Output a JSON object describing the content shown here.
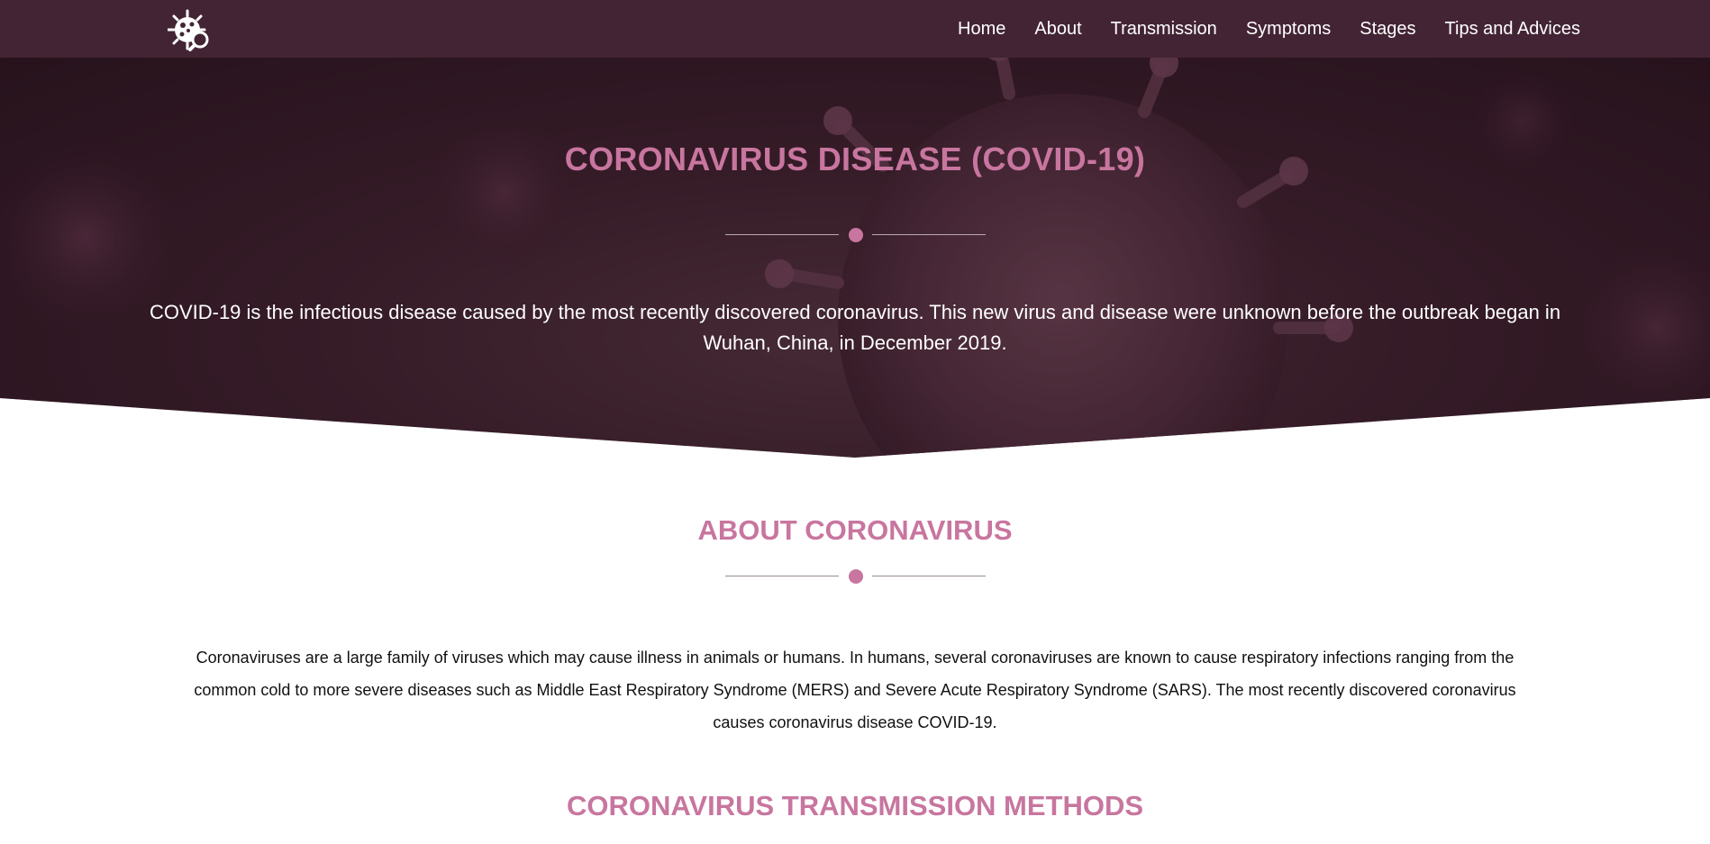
{
  "navbar": {
    "logo_icon": "virus-search-icon",
    "links": [
      "Home",
      "About",
      "Transmission",
      "Symptoms",
      "Stages",
      "Tips and Advices"
    ]
  },
  "hero": {
    "title": "CORONAVIRUS DISEASE (COVID-19)",
    "text": "COVID-19 is the infectious disease caused by the most recently discovered coronavirus. This new virus and disease were unknown before the outbreak began in Wuhan, China, in December 2019."
  },
  "about": {
    "title": "ABOUT CORONAVIRUS",
    "text": "Coronaviruses are a large family of viruses which may cause illness in animals or humans. In humans, several coronaviruses are known to cause respiratory infections ranging from the common cold to more severe diseases such as Middle East Respiratory Syndrome (MERS) and Severe Acute Respiratory Syndrome (SARS). The most recently discovered coronavirus causes coronavirus disease COVID-19."
  },
  "transmission": {
    "title": "CORONAVIRUS TRANSMISSION METHODS"
  },
  "colors": {
    "navbar_bg": "#432434",
    "accent": "#c8769f",
    "hero_bg": "#3f2330",
    "body_text": "#111111"
  }
}
